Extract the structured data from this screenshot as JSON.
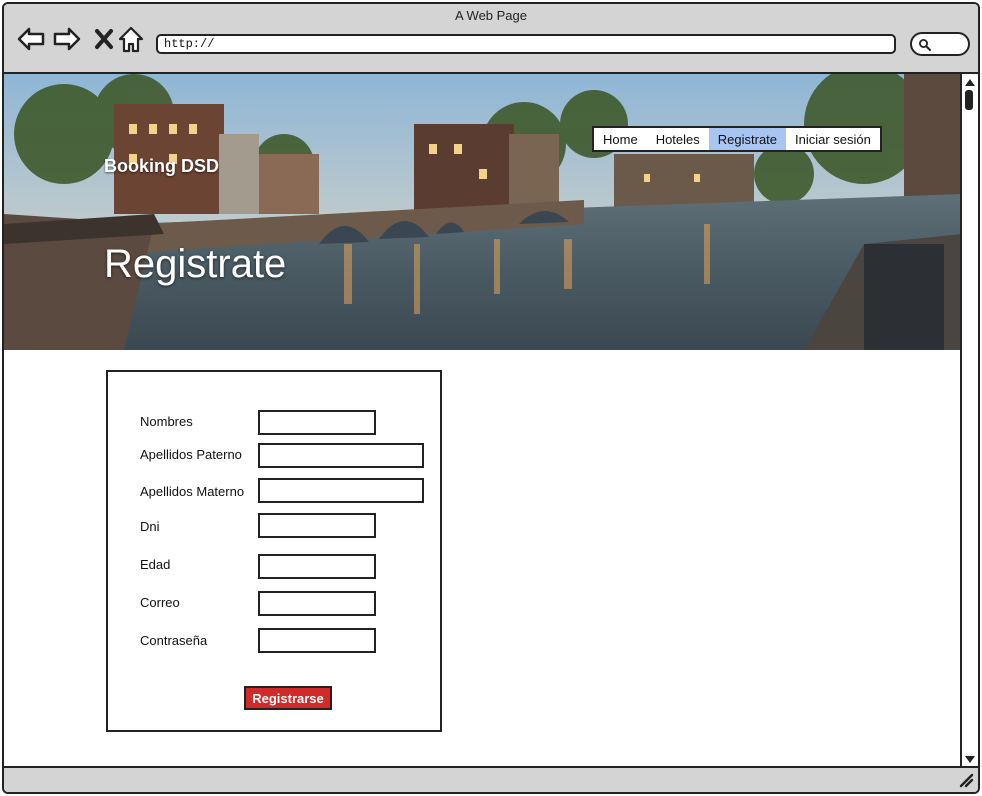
{
  "window": {
    "title": "A Web Page"
  },
  "browser": {
    "url": "http://",
    "icons": [
      "back-icon",
      "forward-icon",
      "close-icon",
      "home-icon",
      "search-icon",
      "resize-grip-icon"
    ]
  },
  "site": {
    "brand": "Booking DSD",
    "hero_title": "Registrate",
    "nav": [
      {
        "label": "Home"
      },
      {
        "label": "Hoteles"
      },
      {
        "label": "Registrate"
      },
      {
        "label": "Iniciar sesión"
      }
    ]
  },
  "form": {
    "fields": [
      {
        "label": "Nombres",
        "value": ""
      },
      {
        "label": "Apellidos Paterno",
        "value": ""
      },
      {
        "label": "Apellidos Materno",
        "value": ""
      },
      {
        "label": "Dni",
        "value": ""
      },
      {
        "label": "Edad",
        "value": ""
      },
      {
        "label": "Correo",
        "value": ""
      },
      {
        "label": "Contraseña",
        "value": ""
      }
    ],
    "submit_label": "Registrarse"
  },
  "colors": {
    "chrome": "#d4d4d4",
    "nav_active": "#a8c4f0",
    "submit": "#d02a2a"
  }
}
